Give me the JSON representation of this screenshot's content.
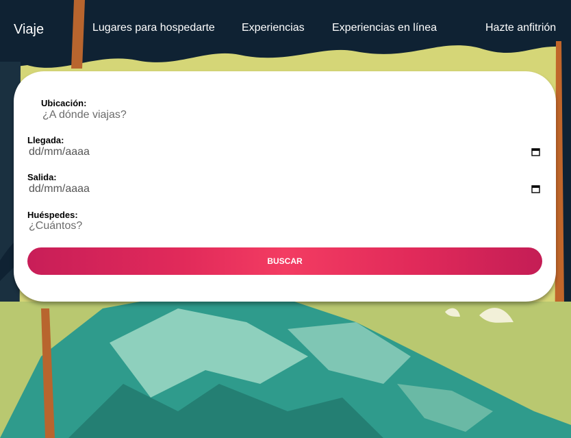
{
  "nav": {
    "logo": "Viaje",
    "links": [
      "Lugares para hospedarte",
      "Experiencias",
      "Experiencias en línea"
    ],
    "host": "Hazte anfitrión"
  },
  "form": {
    "location": {
      "label": "Ubicación:",
      "placeholder": "¿A dónde viajas?"
    },
    "checkin": {
      "label": "Llegada:",
      "placeholder": "dd/mm/aaaa"
    },
    "checkout": {
      "label": "Salida:",
      "placeholder": "dd/mm/aaaa"
    },
    "guests": {
      "label": "Huéspedes:",
      "placeholder": "¿Cuántos?"
    },
    "submit": "BUSCAR"
  },
  "colors": {
    "button_start": "#c81e58",
    "button_mid": "#f33c62",
    "sky": "#d6d677",
    "trees": "#0f2233",
    "mountain": "#2e9a8a"
  },
  "icons": [
    "calendar-icon"
  ]
}
